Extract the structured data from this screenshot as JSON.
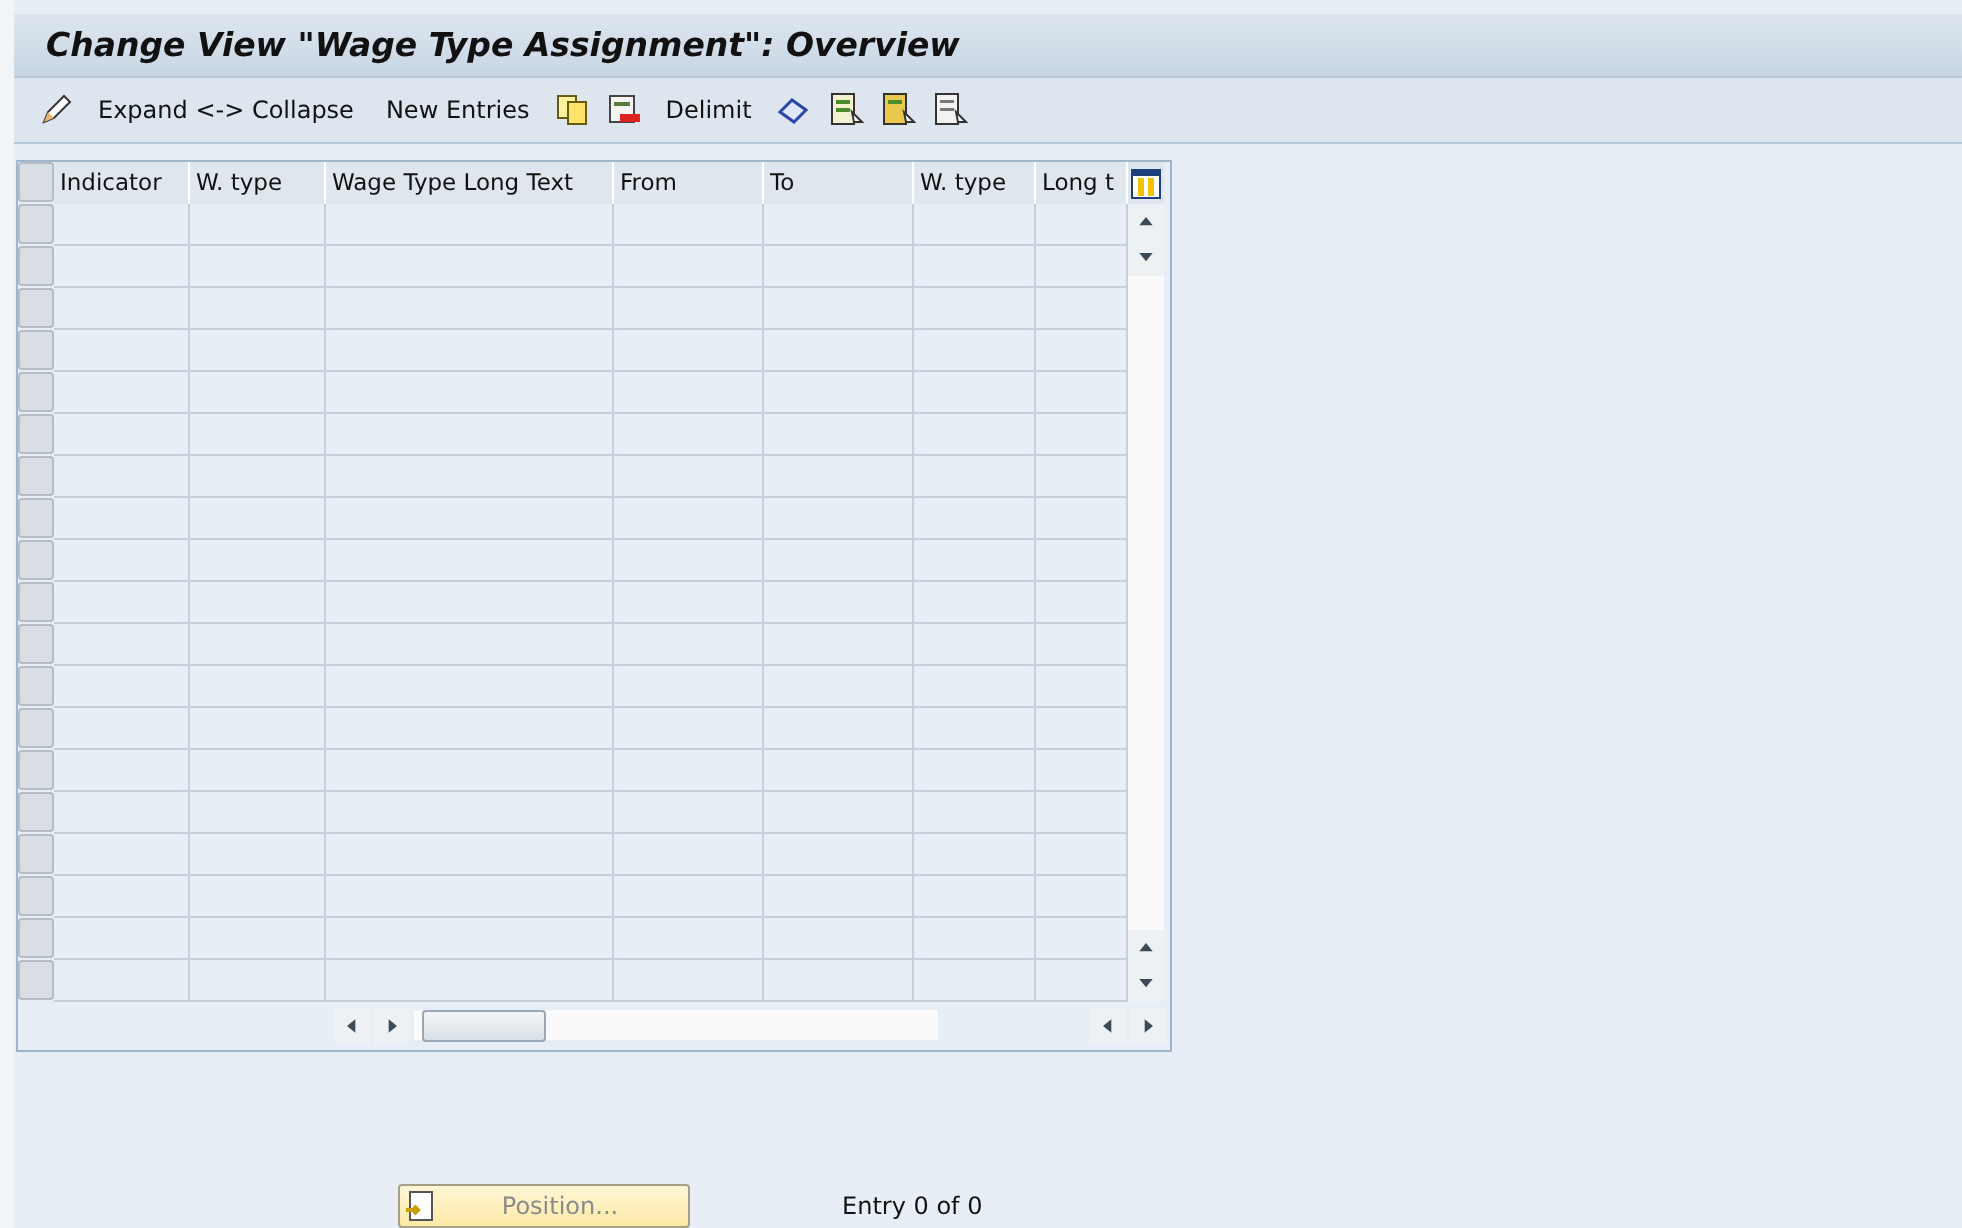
{
  "window": {
    "title": "Change View \"Wage Type Assignment\": Overview"
  },
  "toolbar": [
    {
      "kind": "icon"
    },
    {
      "kind": "text",
      "label": "Expand <-> Collapse"
    },
    {
      "kind": "text",
      "label": "New Entries"
    },
    {
      "kind": "icon"
    },
    {
      "kind": "icon"
    },
    {
      "kind": "text",
      "label": "Delimit"
    },
    {
      "kind": "icon"
    },
    {
      "kind": "icon"
    },
    {
      "kind": "icon"
    },
    {
      "kind": "icon"
    }
  ],
  "table": {
    "columns": [
      "Indicator",
      "W. type",
      "Wage Type Long Text",
      "From",
      "To",
      "W. type",
      "Long t"
    ]
  },
  "footer": {
    "position_button": "Position...",
    "entry_count": "Entry 0 of 0"
  }
}
